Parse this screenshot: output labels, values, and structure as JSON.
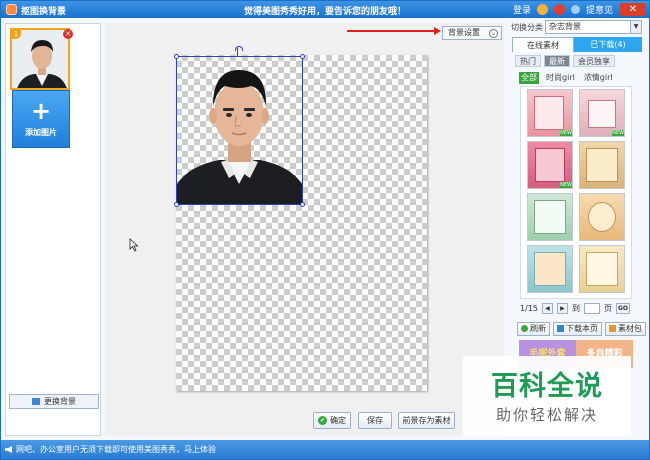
{
  "titlebar": {
    "app_title": "抠图换背景",
    "slogan": "觉得美图秀秀好用，要告诉您的朋友哦！",
    "login": "登录",
    "feedback": "提意见",
    "close": "✕"
  },
  "left": {
    "thumb_index": "1",
    "thumb_close": "✕",
    "add_plus": "+",
    "add_label": "添加图片",
    "change_bg": "更换背景"
  },
  "canvas": {
    "bg_settings": "背景设置",
    "bg_settings_chevron": "⌄"
  },
  "buttons": {
    "confirm": "确定",
    "confirm_icon": "✔",
    "save": "保存",
    "save_as_material": "前景存为素材"
  },
  "right": {
    "category_label": "切换分类",
    "category_value": "杂志背景",
    "tabs": [
      "在线素材",
      "已下载(4)"
    ],
    "filters": [
      "热门",
      "最新",
      "会员独享"
    ],
    "subfilters": [
      "全部",
      "时尚girl",
      "浓情girl"
    ],
    "new_badge": "NEW",
    "page_status": "1/15",
    "page_prev": "◀",
    "page_next": "▶",
    "page_to": "到",
    "page_unit": "页",
    "page_go": "GO",
    "tools": [
      "刷新",
      "下载本页",
      "素材包"
    ],
    "swatches": [
      "毛呢外套",
      "多自精彩"
    ]
  },
  "watermark": {
    "title": "百科全说",
    "subtitle": "助你轻松解决"
  },
  "statusbar": {
    "text": "网吧、办公室用户无须下载即可使用美图秀秀，马上体验"
  },
  "colors": {
    "accent": "#2ea6ef",
    "titlebar": "#1a70cf",
    "selection": "#2a45b8",
    "arrow": "#e0201c",
    "watermark": "#1e9b55"
  }
}
